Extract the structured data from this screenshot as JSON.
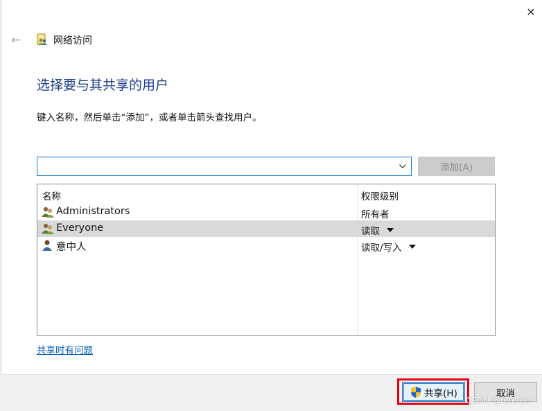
{
  "window": {
    "title": "网络访问",
    "close_glyph": "✕",
    "back_glyph": "←"
  },
  "content": {
    "heading": "选择要与其共享的用户",
    "instruction": "键入名称，然后单击“添加”，或者单击箭头查找用户。",
    "name_input": {
      "value": "",
      "placeholder": ""
    },
    "add_button": "添加(A)",
    "list": {
      "columns": [
        "名称",
        "权限级别"
      ],
      "rows": [
        {
          "name": "Administrators",
          "permission": "所有者",
          "icon": "user-group-icon",
          "has_dropdown": false,
          "selected": false
        },
        {
          "name": "Everyone",
          "permission": "读取",
          "icon": "user-group-icon",
          "has_dropdown": true,
          "selected": true
        },
        {
          "name": "意中人",
          "permission": "读取/写入",
          "icon": "user-icon",
          "has_dropdown": true,
          "selected": false
        }
      ]
    },
    "help_link": "共享时有问题"
  },
  "footer": {
    "share_button": "共享(H)",
    "cancel_button": "取消"
  },
  "watermark": "CSDN @fefefeef",
  "colors": {
    "heading": "#1f3e8c",
    "link": "#0a5fb4",
    "selection": "#d9d9d9",
    "focus_border": "#0f6fc6",
    "highlight_box": "#e60012"
  }
}
